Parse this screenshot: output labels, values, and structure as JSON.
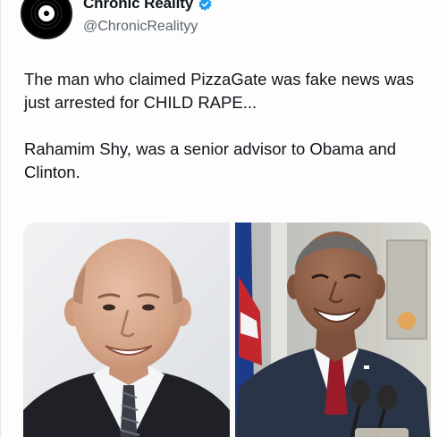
{
  "author": {
    "display_name": "Chronic Reality",
    "handle": "@ChronicRealityy",
    "avatar_icon": "vinyl-record-icon",
    "verified_icon": "verified-badge-icon",
    "verified_color": "#1d9bf0"
  },
  "post": {
    "paragraphs": [
      "The man who claimed PizzaGate was fake news was just arrested for CHILD RAPE...",
      "Rahamim Shy, was a senior advisor to Obama and Clinton."
    ]
  },
  "media": {
    "images": [
      {
        "name": "photo-bald-man-suit"
      },
      {
        "name": "photo-smiling-man-podium"
      }
    ]
  },
  "colors": {
    "text": "#0f1419",
    "secondary_text": "#5c6670"
  }
}
